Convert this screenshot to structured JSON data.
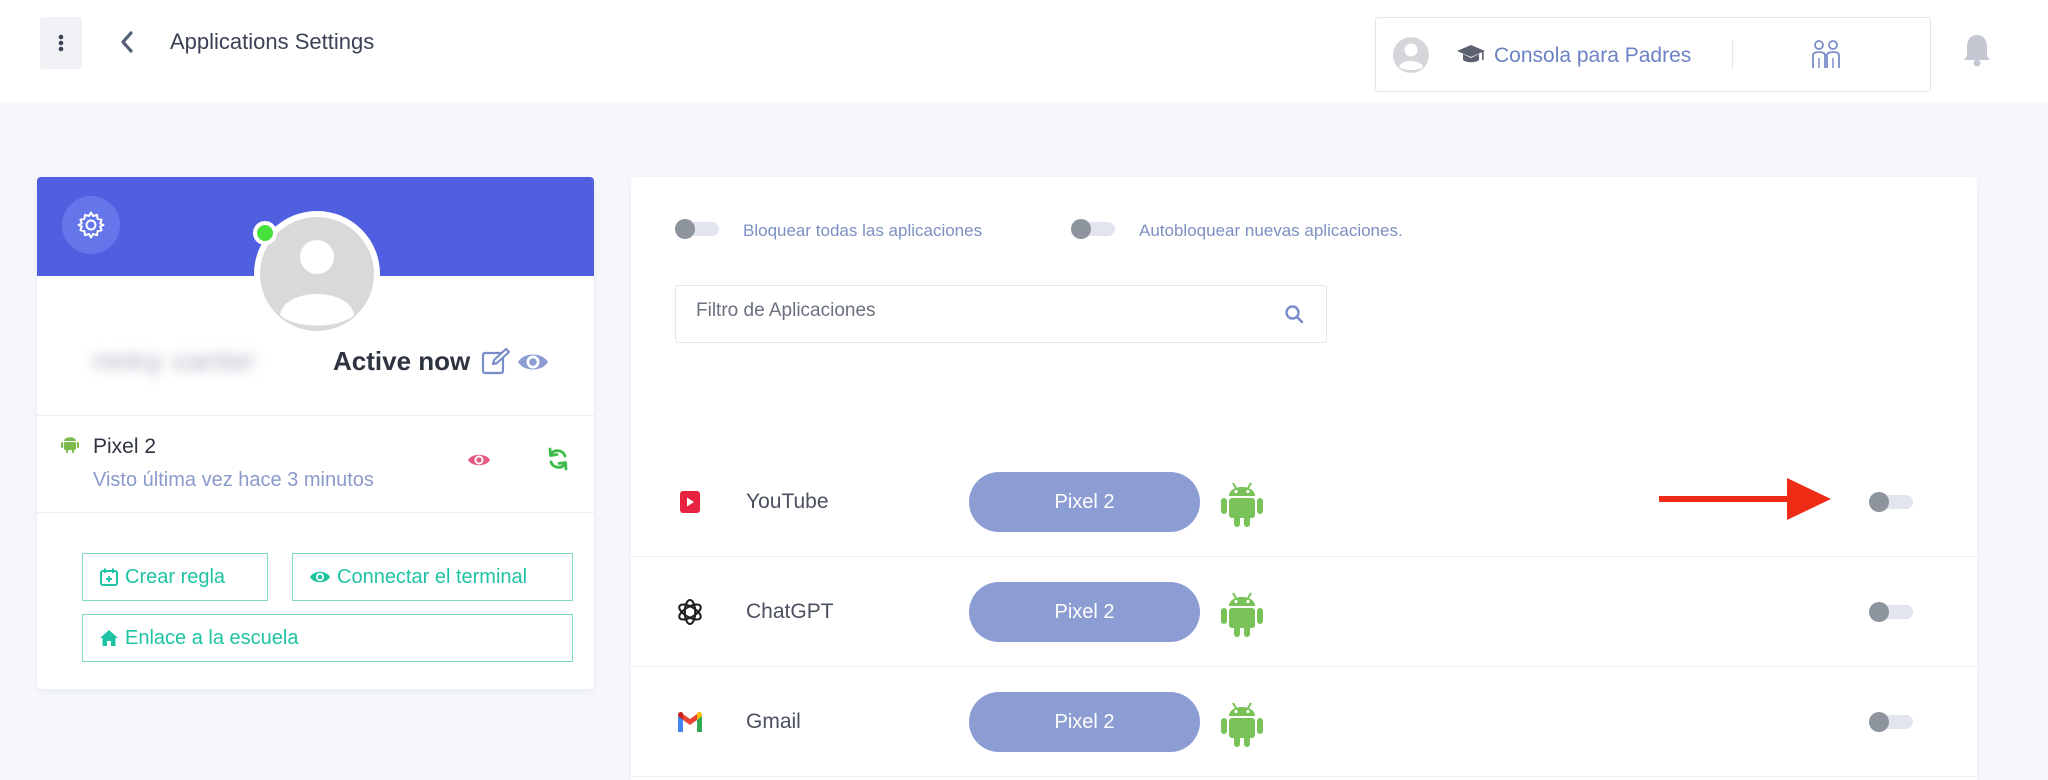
{
  "header": {
    "title": "Applications Settings",
    "console_label": "Consola para Padres"
  },
  "profile": {
    "user_name": "remy carter",
    "status": "Active now",
    "device": {
      "name": "Pixel 2",
      "last_seen": "Visto última vez hace 3 minutos"
    },
    "buttons": {
      "create_rule": "Crear regla",
      "connect_terminal": "Connectar el terminal",
      "school_link": "Enlace a la escuela"
    }
  },
  "apps_panel": {
    "block_all_label": "Bloquear todas las aplicaciones",
    "block_all_on": false,
    "autoblock_label": "Autobloquear nuevas aplicaciones.",
    "autoblock_on": false,
    "filter_placeholder": "Filtro de Aplicaciones",
    "apps": [
      {
        "name": "YouTube",
        "device": "Pixel 2",
        "blocked": false,
        "icon": "youtube-icon"
      },
      {
        "name": "ChatGPT",
        "device": "Pixel 2",
        "blocked": false,
        "icon": "chatgpt-icon"
      },
      {
        "name": "Gmail",
        "device": "Pixel 2",
        "blocked": false,
        "icon": "gmail-icon"
      }
    ]
  },
  "colors": {
    "banner": "#4f5fe0",
    "accent_teal": "#1ec3a3",
    "pill": "#8b9dd2",
    "android_green": "#78c257",
    "annotation_arrow": "#ee2b14"
  }
}
